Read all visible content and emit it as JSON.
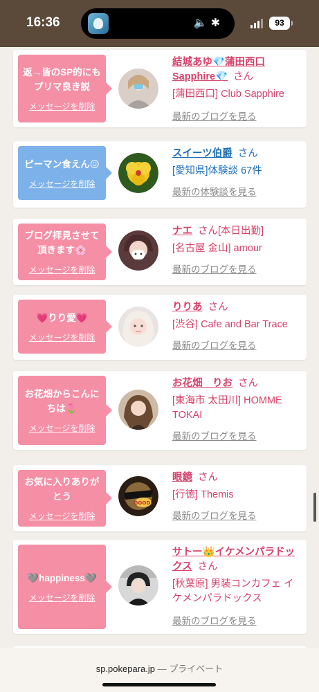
{
  "status_bar": {
    "time": "16:36",
    "battery": "93",
    "icons": [
      "mute-icon",
      "bluetooth-icon",
      "signal-icon",
      "battery-icon"
    ]
  },
  "cards": [
    {
      "message": "返→皆のSP的にもプリマ良き説",
      "delete_label": "メッセージを削除",
      "bubble_color": "pink",
      "name": "結城あゆ💎蒲田西口Sapphire💎",
      "name_color": "pink",
      "san": "さん",
      "extra": "",
      "shop": "[蒲田西口] Club Sapphire",
      "link": "最新のブログを見る"
    },
    {
      "message": "ピーマン食えん😖",
      "delete_label": "メッセージを削除",
      "bubble_color": "blue",
      "name": "スイーツ伯爵",
      "name_color": "blue",
      "san": "さん",
      "extra": "",
      "shop": "[愛知県]体験談 67件",
      "link": "最新の体験談を見る"
    },
    {
      "message": "ブログ拝見させて頂きます🌸",
      "delete_label": "メッセージを削除",
      "bubble_color": "pink",
      "name": "ナエ",
      "name_color": "pink",
      "san": "さん",
      "extra": "[本日出勤]",
      "shop": "[名古屋 金山] amour",
      "link": "最新のブログを見る"
    },
    {
      "message": "💗りり愛💗",
      "delete_label": "メッセージを削除",
      "bubble_color": "pink",
      "name": "りりあ",
      "name_color": "pink",
      "san": "さん",
      "extra": "",
      "shop": "[渋谷] Cafe and Bar Trace",
      "link": "最新のブログを見る"
    },
    {
      "message": "お花畑からこんにちは🌷",
      "delete_label": "メッセージを削除",
      "bubble_color": "pink",
      "name": "お花畑　りお",
      "name_color": "pink",
      "san": "さん",
      "extra": "",
      "shop": "[東海市 太田川] HOMME TOKAI",
      "link": "最新のブログを見る"
    },
    {
      "message": "お気に入りありがとう",
      "delete_label": "メッセージを削除",
      "bubble_color": "pink",
      "name": "眼鏡",
      "name_color": "pink",
      "san": "さん",
      "extra": "",
      "shop": "[行徳] Themis",
      "link": "最新のブログを見る"
    },
    {
      "message": "🩶happiness🩶",
      "delete_label": "メッセージを削除",
      "bubble_color": "pink",
      "name": "サトー👑イケメンパラドックス",
      "name_color": "pink",
      "san": "さん",
      "extra": "",
      "shop": "[秋葉原] 男装コンカフェ イケメンパラドックス",
      "link": "最新のブログを見る"
    }
  ],
  "footer": {
    "domain": "sp.pokepara.jp",
    "separator": "—",
    "mode": "プライベート"
  },
  "colors": {
    "pink": "#f58fa6",
    "blue": "#7cb1ea",
    "name_pink": "#d6416a",
    "name_blue": "#1d6fb8",
    "status_bar": "#5b4a3a"
  }
}
